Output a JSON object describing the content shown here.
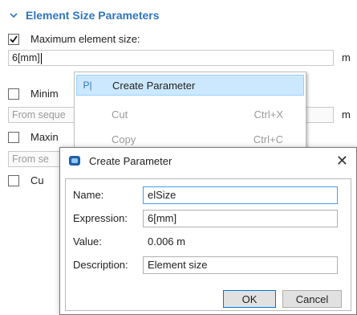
{
  "section": {
    "title": "Element Size Parameters"
  },
  "settings": {
    "max_size": {
      "checked": true,
      "label": "Maximum element size:",
      "value": "6[mm]",
      "unit": "m"
    },
    "min_size": {
      "checked": false,
      "label": "Minim"
    },
    "field_row2": {
      "placeholder": "From seque",
      "unit": "m"
    },
    "max_growth": {
      "checked": false,
      "label": "Maxin"
    },
    "field_row3": {
      "placeholder": "From se"
    },
    "curvature": {
      "checked": false,
      "label": "Cu"
    }
  },
  "context_menu": {
    "items": [
      {
        "icon": "P|",
        "label": "Create Parameter",
        "shortcut": "",
        "highlighted": true,
        "enabled": true
      },
      {
        "icon": "",
        "label": "Cut",
        "shortcut": "Ctrl+X",
        "highlighted": false,
        "enabled": false
      },
      {
        "icon": "",
        "label": "Copy",
        "shortcut": "Ctrl+C",
        "highlighted": false,
        "enabled": false
      }
    ]
  },
  "dialog": {
    "title": "Create Parameter",
    "close_glyph": "✕",
    "name_label": "Name:",
    "name_value": "elSize",
    "expression_label": "Expression:",
    "expression_value": "6[mm]",
    "value_label": "Value:",
    "value_value": "0.006 m",
    "description_label": "Description:",
    "description_value": "Element size",
    "ok_label": "OK",
    "cancel_label": "Cancel"
  },
  "colors": {
    "accent": "#2f76c0",
    "highlight": "#cce8ff"
  }
}
